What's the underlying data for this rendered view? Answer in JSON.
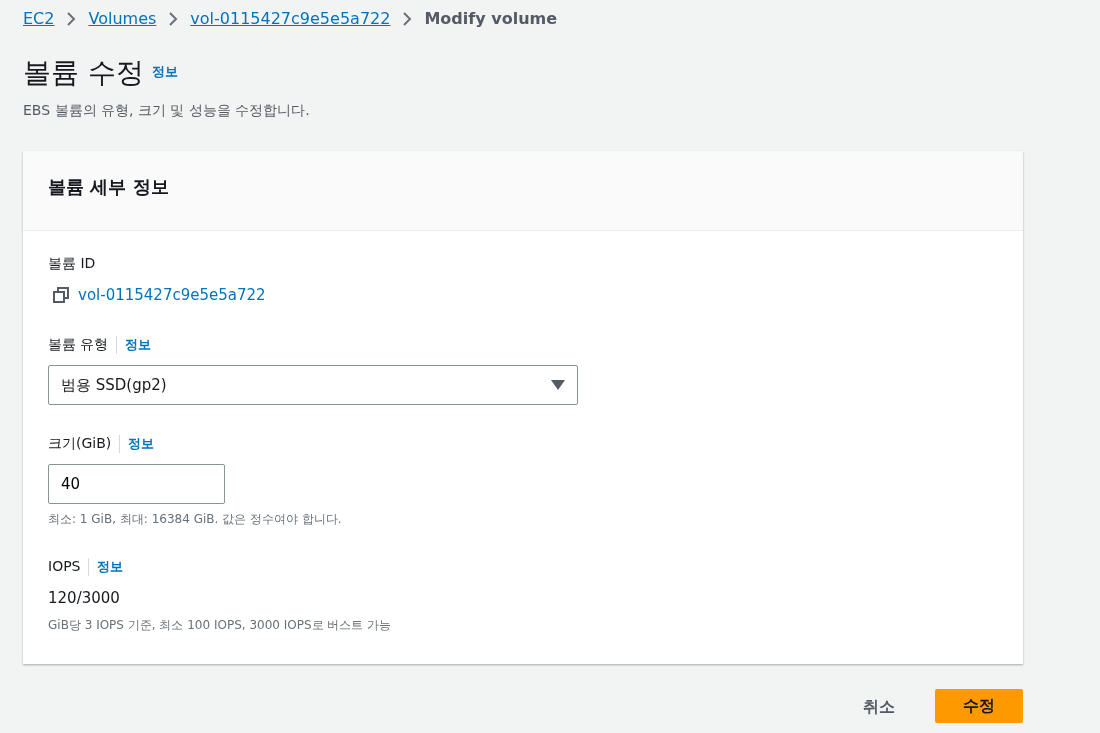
{
  "breadcrumb": [
    {
      "label": "EC2",
      "link": true
    },
    {
      "label": "Volumes",
      "link": true
    },
    {
      "label": "vol-0115427c9e5e5a722",
      "link": true
    },
    {
      "label": "Modify volume",
      "link": false
    }
  ],
  "page": {
    "title": "볼륨 수정",
    "info": "정보",
    "description": "EBS 볼륨의 유형, 크기 및 성능을 수정합니다."
  },
  "card": {
    "title": "볼륨 세부 정보",
    "fields": [
      {
        "kind": "copy",
        "label": "볼륨 ID",
        "value": "vol-0115427c9e5e5a722"
      },
      {
        "kind": "select",
        "label": "볼륨 유형",
        "info": "정보",
        "value": "범용 SSD(gp2)"
      },
      {
        "kind": "input",
        "label": "크기(GiB)",
        "info": "정보",
        "value": "40",
        "hint": "최소: 1 GiB, 최대: 16384 GiB. 값은 정수여야 합니다."
      },
      {
        "kind": "text",
        "label": "IOPS",
        "info": "정보",
        "value": "120/3000",
        "hint": "GiB당 3 IOPS 기준, 최소 100 IOPS, 3000 IOPS로 버스트 가능"
      }
    ]
  },
  "buttons": [
    {
      "label": "취소",
      "primary": false
    },
    {
      "label": "수정",
      "primary": true
    }
  ]
}
